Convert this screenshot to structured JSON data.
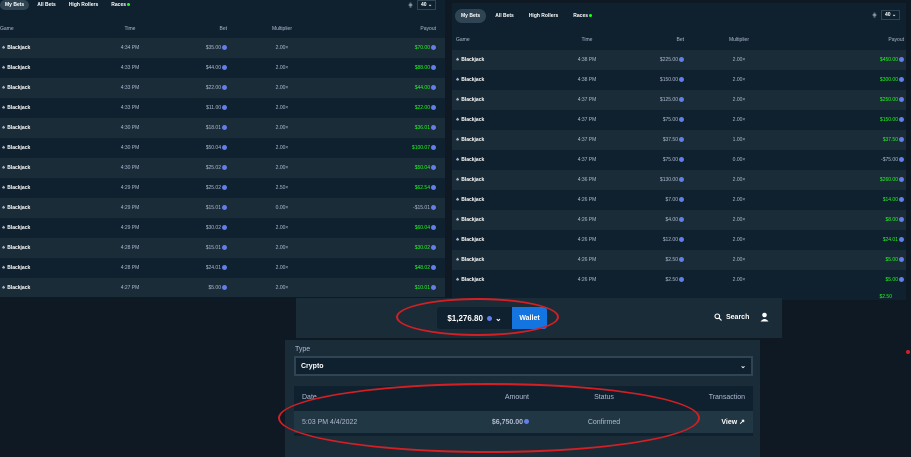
{
  "left": {
    "tabs": [
      {
        "label": "My Bets",
        "active": true
      },
      {
        "label": "All Bets",
        "active": false
      },
      {
        "label": "High Rollers",
        "active": false
      },
      {
        "label": "Races",
        "active": false,
        "live_dot": true
      }
    ],
    "count_select": "40",
    "columns": [
      "Game",
      "Time",
      "Bet",
      "Multiplier",
      "Payout"
    ],
    "rows": [
      {
        "game": "Blackjack",
        "time": "4:34 PM",
        "bet": "$35.00",
        "multiplier": "2.00×",
        "payout": "$70.00",
        "win": true
      },
      {
        "game": "Blackjack",
        "time": "4:33 PM",
        "bet": "$44.00",
        "multiplier": "2.00×",
        "payout": "$88.00",
        "win": true
      },
      {
        "game": "Blackjack",
        "time": "4:33 PM",
        "bet": "$22.00",
        "multiplier": "2.00×",
        "payout": "$44.00",
        "win": true
      },
      {
        "game": "Blackjack",
        "time": "4:33 PM",
        "bet": "$11.00",
        "multiplier": "2.00×",
        "payout": "$22.00",
        "win": true
      },
      {
        "game": "Blackjack",
        "time": "4:30 PM",
        "bet": "$18.01",
        "multiplier": "2.00×",
        "payout": "$36.01",
        "win": true
      },
      {
        "game": "Blackjack",
        "time": "4:30 PM",
        "bet": "$50.04",
        "multiplier": "2.00×",
        "payout": "$100.07",
        "win": true
      },
      {
        "game": "Blackjack",
        "time": "4:30 PM",
        "bet": "$25.02",
        "multiplier": "2.00×",
        "payout": "$50.04",
        "win": true
      },
      {
        "game": "Blackjack",
        "time": "4:29 PM",
        "bet": "$25.02",
        "multiplier": "2.50×",
        "payout": "$62.54",
        "win": true
      },
      {
        "game": "Blackjack",
        "time": "4:29 PM",
        "bet": "$15.01",
        "multiplier": "0.00×",
        "payout": "-$15.01",
        "win": false
      },
      {
        "game": "Blackjack",
        "time": "4:29 PM",
        "bet": "$30.02",
        "multiplier": "2.00×",
        "payout": "$60.04",
        "win": true
      },
      {
        "game": "Blackjack",
        "time": "4:28 PM",
        "bet": "$15.01",
        "multiplier": "2.00×",
        "payout": "$30.02",
        "win": true
      },
      {
        "game": "Blackjack",
        "time": "4:28 PM",
        "bet": "$24.01",
        "multiplier": "2.00×",
        "payout": "$48.02",
        "win": true
      },
      {
        "game": "Blackjack",
        "time": "4:27 PM",
        "bet": "$5.00",
        "multiplier": "2.00×",
        "payout": "$10.01",
        "win": true
      }
    ]
  },
  "right": {
    "tabs": [
      {
        "label": "My Bets",
        "active": true
      },
      {
        "label": "All Bets",
        "active": false
      },
      {
        "label": "High Rollers",
        "active": false
      },
      {
        "label": "Races",
        "active": false,
        "live_dot": true
      }
    ],
    "count_select": "40",
    "columns": [
      "Game",
      "Time",
      "Bet",
      "Multiplier",
      "Payout"
    ],
    "rows": [
      {
        "game": "Blackjack",
        "time": "4:38 PM",
        "bet": "$225.00",
        "multiplier": "2.00×",
        "payout": "$450.00",
        "win": true
      },
      {
        "game": "Blackjack",
        "time": "4:38 PM",
        "bet": "$150.00",
        "multiplier": "2.00×",
        "payout": "$300.00",
        "win": true
      },
      {
        "game": "Blackjack",
        "time": "4:37 PM",
        "bet": "$125.00",
        "multiplier": "2.00×",
        "payout": "$250.00",
        "win": true
      },
      {
        "game": "Blackjack",
        "time": "4:37 PM",
        "bet": "$75.00",
        "multiplier": "2.00×",
        "payout": "$150.00",
        "win": true
      },
      {
        "game": "Blackjack",
        "time": "4:37 PM",
        "bet": "$37.50",
        "multiplier": "1.00×",
        "payout": "$37.50",
        "win": true
      },
      {
        "game": "Blackjack",
        "time": "4:37 PM",
        "bet": "$75.00",
        "multiplier": "0.00×",
        "payout": "-$75.00",
        "win": false
      },
      {
        "game": "Blackjack",
        "time": "4:36 PM",
        "bet": "$130.00",
        "multiplier": "2.00×",
        "payout": "$260.00",
        "win": true
      },
      {
        "game": "Blackjack",
        "time": "4:26 PM",
        "bet": "$7.00",
        "multiplier": "2.00×",
        "payout": "$14.00",
        "win": true
      },
      {
        "game": "Blackjack",
        "time": "4:26 PM",
        "bet": "$4.00",
        "multiplier": "2.00×",
        "payout": "$8.00",
        "win": true
      },
      {
        "game": "Blackjack",
        "time": "4:26 PM",
        "bet": "$12.00",
        "multiplier": "2.00×",
        "payout": "$24.01",
        "win": true
      },
      {
        "game": "Blackjack",
        "time": "4:26 PM",
        "bet": "$2.50",
        "multiplier": "2.00×",
        "payout": "$5.00",
        "win": true
      },
      {
        "game": "Blackjack",
        "time": "4:26 PM",
        "bet": "$2.50",
        "multiplier": "2.00×",
        "payout": "$5.00",
        "win": true
      }
    ],
    "partial_payout": "$2.50"
  },
  "wallet": {
    "balance": "$1,276.80",
    "wallet_label": "Wallet",
    "search_label": "Search"
  },
  "transactions": {
    "type_label": "Type",
    "type_value": "Crypto",
    "columns": {
      "date": "Date",
      "amount": "Amount",
      "status": "Status",
      "transaction": "Transaction"
    },
    "row": {
      "date": "5:03 PM 4/4/2022",
      "amount": "$6,750.00",
      "status": "Confirmed",
      "view": "View"
    }
  },
  "colors": {
    "win_green": "#1fff20",
    "annotation_red": "#d41f24",
    "wallet_blue": "#1475e1",
    "coin_blue": "#627eea"
  }
}
